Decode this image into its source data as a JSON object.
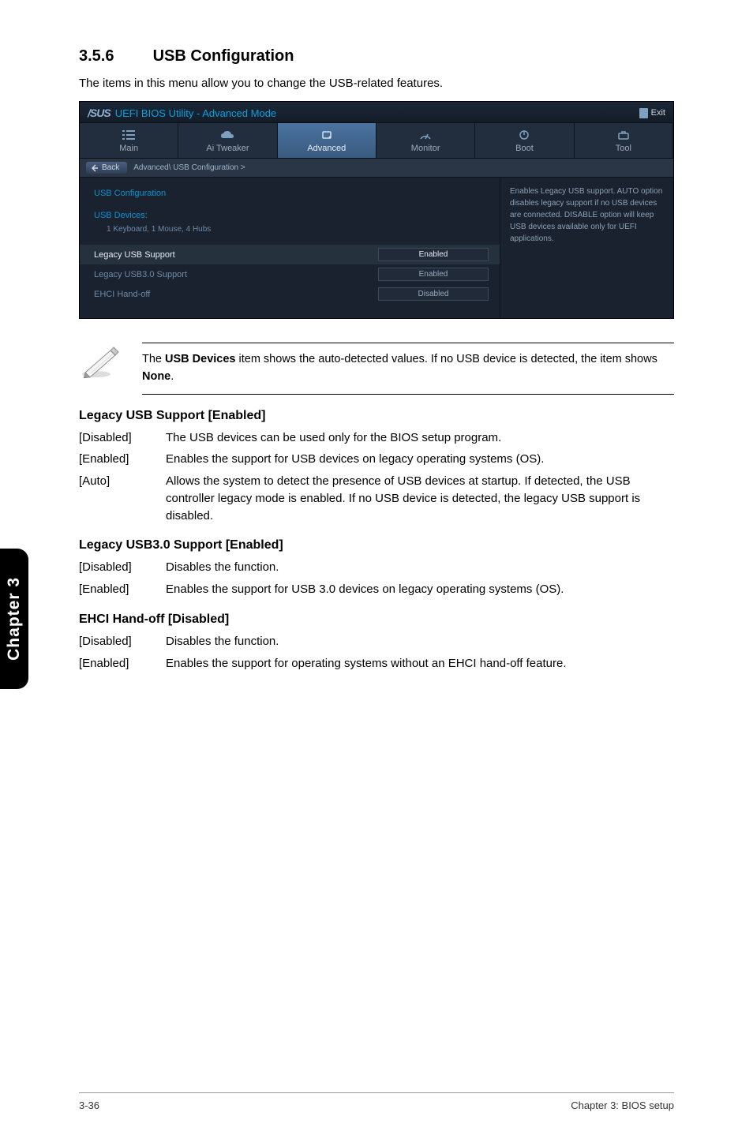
{
  "section": {
    "number": "3.5.6",
    "title": "USB Configuration",
    "intro": "The items in this menu allow you to change the USB-related features."
  },
  "bios": {
    "brand": "/SUS",
    "header_title": "UEFI BIOS Utility - Advanced Mode",
    "exit_label": "Exit",
    "tabs": {
      "main": "Main",
      "ai_tweaker": "Ai Tweaker",
      "advanced": "Advanced",
      "monitor": "Monitor",
      "boot": "Boot",
      "tool": "Tool"
    },
    "breadcrumb": {
      "back": "Back",
      "path": "Advanced\\ USB Configuration  >"
    },
    "items": {
      "usb_configuration": "USB Configuration",
      "usb_devices_label": "USB Devices:",
      "usb_devices_value": "1 Keyboard, 1 Mouse, 4 Hubs",
      "legacy_usb_support": {
        "label": "Legacy USB Support",
        "value": "Enabled"
      },
      "legacy_usb30_support": {
        "label": "Legacy USB3.0 Support",
        "value": "Enabled"
      },
      "ehci_handoff": {
        "label": "EHCI Hand-off",
        "value": "Disabled"
      }
    },
    "help_text": "Enables Legacy USB support. AUTO option disables legacy support if no USB devices are connected. DISABLE option will keep USB devices available only for UEFI applications."
  },
  "note": {
    "prefix": "The ",
    "bold1": "USB Devices",
    "mid": " item shows the auto-detected values. If no USB device is detected, the item shows ",
    "bold2": "None",
    "suffix": "."
  },
  "sections": {
    "legacy_usb": {
      "title": "Legacy USB Support [Enabled]",
      "rows": {
        "disabled": {
          "term": "[Disabled]",
          "desc": "The USB devices can be used only for the BIOS setup program."
        },
        "enabled": {
          "term": "[Enabled]",
          "desc": "Enables the support for USB devices on legacy operating systems (OS)."
        },
        "auto": {
          "term": "[Auto]",
          "desc": "Allows the system to detect the presence of USB devices at startup. If detected, the USB controller legacy mode is enabled. If no USB device is detected, the legacy USB support is disabled."
        }
      }
    },
    "legacy_usb30": {
      "title": "Legacy USB3.0 Support [Enabled]",
      "rows": {
        "disabled": {
          "term": "[Disabled]",
          "desc": "Disables the function."
        },
        "enabled": {
          "term": "[Enabled]",
          "desc": "Enables the support for USB 3.0 devices on legacy operating systems (OS)."
        }
      }
    },
    "ehci": {
      "title": "EHCI Hand-off [Disabled]",
      "rows": {
        "disabled": {
          "term": "[Disabled]",
          "desc": "Disables the function."
        },
        "enabled": {
          "term": "[Enabled]",
          "desc": "Enables the support for operating systems without an EHCI hand-off feature."
        }
      }
    }
  },
  "chapter_tab": "Chapter 3",
  "footer": {
    "left": "3-36",
    "right": "Chapter 3: BIOS setup"
  }
}
